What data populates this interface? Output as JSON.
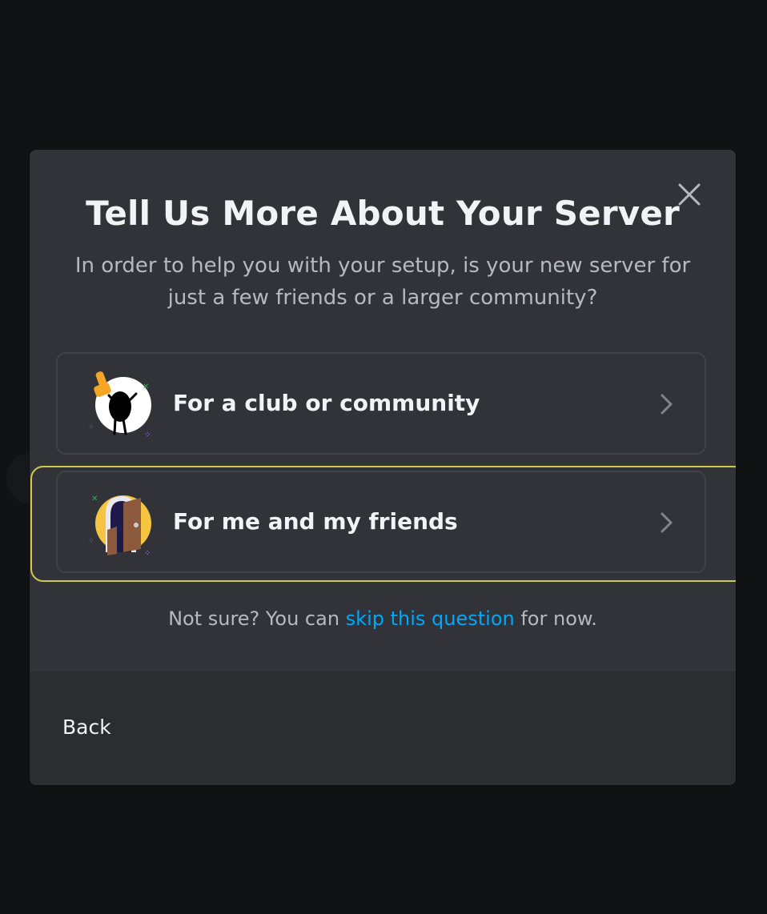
{
  "modal": {
    "title": "Tell Us More About Your Server",
    "subtitle": "In order to help you with your setup, is your new server for just a few friends or a larger community?",
    "close_icon": "close-icon",
    "options": [
      {
        "label": "For a club or community",
        "icon": "club-community-illustration",
        "chevron": "chevron-right-icon"
      },
      {
        "label": "For me and my friends",
        "icon": "friends-door-illustration",
        "chevron": "chevron-right-icon"
      }
    ],
    "skip": {
      "prefix": "Not sure? You can ",
      "link": "skip this question",
      "suffix": " for now."
    },
    "back_label": "Back"
  },
  "colors": {
    "backdrop": "#111214",
    "modal_bg": "#313338",
    "footer_bg": "#2b2d31",
    "option_border": "#404249",
    "focus_ring": "#cfc84a",
    "link": "#00a8fc",
    "heading": "#f2f3f5",
    "muted": "#b5bac1"
  }
}
